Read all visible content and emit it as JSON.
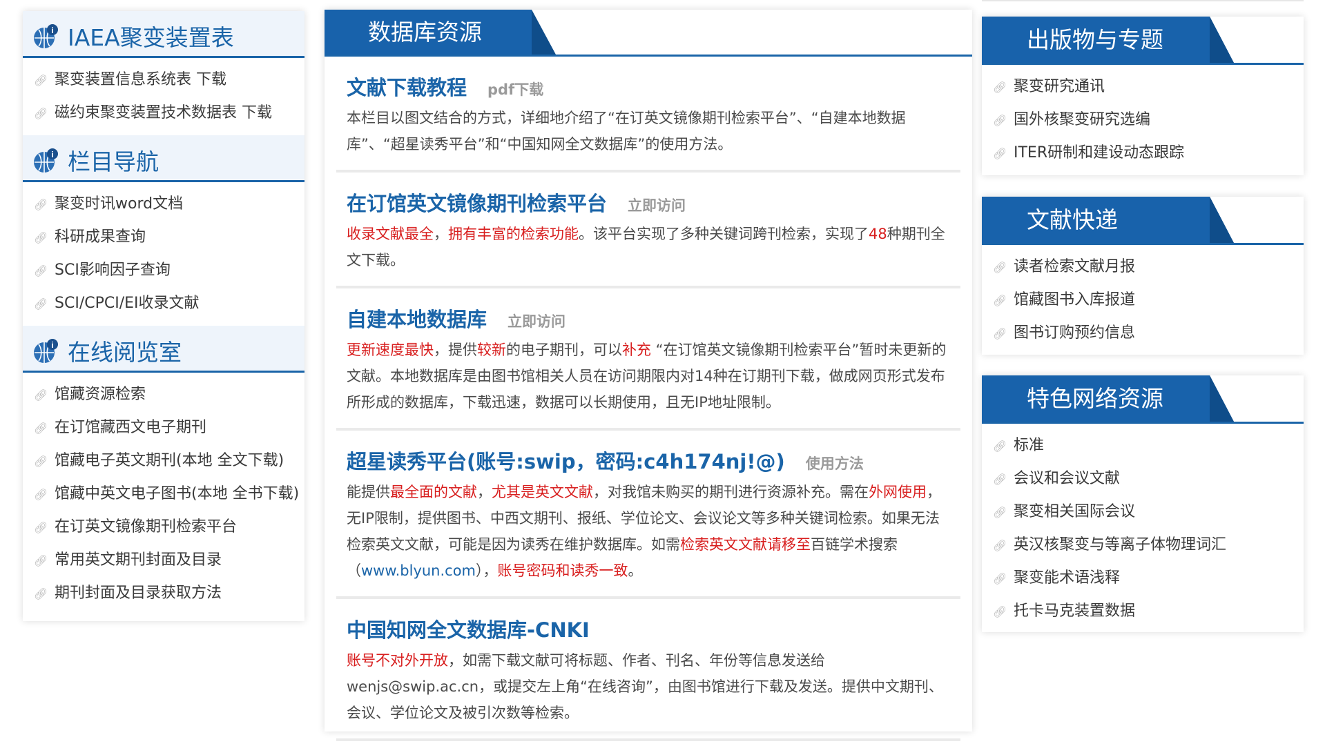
{
  "colors": {
    "accent": "#1a64a8",
    "highlight": "#d81e1e",
    "tab_bg": "#1862ab"
  },
  "left": {
    "sections": [
      {
        "title": "IAEA聚变装置表",
        "icon": "globe-info-icon",
        "items": [
          "聚变装置信息系统表 下载",
          "磁约束聚变装置技术数据表 下载"
        ]
      },
      {
        "title": "栏目导航",
        "icon": "globe-info-icon",
        "items": [
          "聚变时讯word文档",
          "科研成果查询",
          "SCI影响因子查询",
          "SCI/CPCI/EI收录文献"
        ]
      },
      {
        "title": "在线阅览室",
        "icon": "globe-info-icon",
        "items": [
          "馆藏资源检索",
          "在订馆藏西文电子期刊",
          "馆藏电子英文期刊(本地 全文下载)",
          "馆藏中英文电子图书(本地 全书下载)",
          "在订英文镜像期刊检索平台",
          "常用英文期刊封面及目录",
          "期刊封面及目录获取方法"
        ]
      }
    ]
  },
  "middle": {
    "tab": "数据库资源",
    "entries": [
      {
        "title": "文献下载教程",
        "link": "pdf下载",
        "desc": [
          {
            "t": "本栏目以图文结合的方式，详细地介绍了“在订英文镜像期刊检索平台”、“自建本地数据库”、“超星读秀平台”和“中国知网全文数据库”的使用方法。"
          }
        ]
      },
      {
        "title": "在订馆英文镜像期刊检索平台",
        "link": "立即访问",
        "desc": [
          {
            "t": "收录文献最全",
            "c": "red"
          },
          {
            "t": "，"
          },
          {
            "t": "拥有丰富的检索功能",
            "c": "red"
          },
          {
            "t": "。该平台实现了多种关键词跨刊检索，实现了"
          },
          {
            "t": "48",
            "c": "red"
          },
          {
            "t": "种期刊全文下载。"
          }
        ]
      },
      {
        "title": "自建本地数据库",
        "link": "立即访问",
        "desc": [
          {
            "t": "更新速度最快",
            "c": "red"
          },
          {
            "t": "，提供"
          },
          {
            "t": "较新",
            "c": "red"
          },
          {
            "t": "的电子期刊，可以"
          },
          {
            "t": "补充",
            "c": "red"
          },
          {
            "t": " “在订馆英文镜像期刊检索平台”暂时未更新的文献。本地数据库是由图书馆相关人员在访问期限内对14种在订期刊下载，做成网页形式发布所形成的数据库，下载迅速，数据可以长期使用，且无IP地址限制。"
          }
        ]
      },
      {
        "title": "超星读秀平台(账号:swip，密码:c4h174nj!@)",
        "link": "使用方法",
        "desc": [
          {
            "t": "能提供"
          },
          {
            "t": "最全面的文献",
            "c": "red"
          },
          {
            "t": "，"
          },
          {
            "t": "尤其是英文文献",
            "c": "red"
          },
          {
            "t": "，对我馆未购买的期刊进行资源补充。需在"
          },
          {
            "t": "外网使用",
            "c": "red"
          },
          {
            "t": "，无IP限制，提供图书、中西文期刊、报纸、学位论文、会议论文等多种关键词检索。如果无法检索英文文献，可能是因为读秀在维护数据库。如需"
          },
          {
            "t": "检索英文文献请移至",
            "c": "red"
          },
          {
            "t": "百链学术搜索（"
          },
          {
            "t": "www.blyun.com",
            "c": "blue"
          },
          {
            "t": "），"
          },
          {
            "t": "账号密码和读秀一致",
            "c": "red"
          },
          {
            "t": "。"
          }
        ]
      },
      {
        "title": "中国知网全文数据库-CNKI",
        "link": "",
        "desc": [
          {
            "t": "账号不对外开放",
            "c": "red"
          },
          {
            "t": "，如需下载文献可将标题、作者、刊名、年份等信息发送给wenjs@swip.ac.cn，或提交左上角“在线咨询”，由图书馆进行下载及发送。提供中文期刊、会议、学位论文及被引次数等检索。"
          }
        ]
      }
    ]
  },
  "right": {
    "panels": [
      {
        "title": "出版物与专题",
        "items": [
          "聚变研究通讯",
          "国外核聚变研究选编",
          "ITER研制和建设动态跟踪"
        ]
      },
      {
        "title": "文献快递",
        "items": [
          "读者检索文献月报",
          "馆藏图书入库报道",
          "图书订购预约信息"
        ]
      },
      {
        "title": "特色网络资源",
        "items": [
          "标准",
          "会议和会议文献",
          "聚变相关国际会议",
          "英汉核聚变与等离子体物理词汇",
          "聚变能术语浅释",
          "托卡马克装置数据"
        ]
      }
    ]
  }
}
